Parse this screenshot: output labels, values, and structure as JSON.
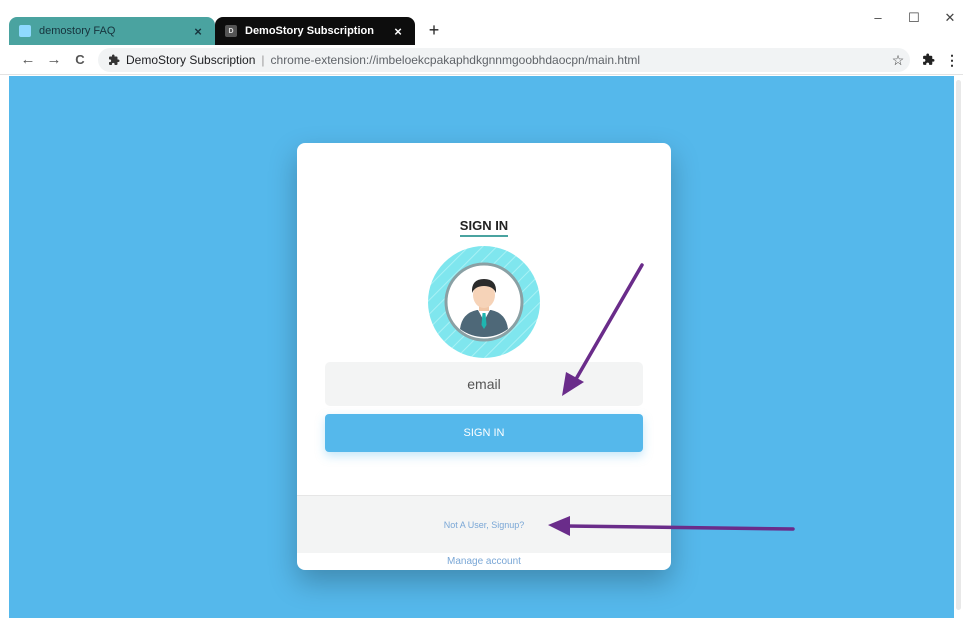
{
  "browser": {
    "tabs": [
      {
        "title": "demostory FAQ",
        "close": "×"
      },
      {
        "title": "DemoStory Subscription",
        "favicon_letter": "D",
        "close": "×"
      }
    ],
    "new_tab": "+",
    "window_controls": {
      "minimize": "–",
      "maximize": "☐",
      "close": "✕"
    },
    "nav": {
      "back": "←",
      "forward": "→",
      "reload": "C"
    },
    "omnibox": {
      "site_name": "DemoStory Subscription",
      "separator": "|",
      "url": "chrome-extension://imbeloekcpakaphdkgnnmgoobhdaocpn/main.html"
    },
    "toolbar_icons": {
      "bookmark": "☆",
      "extensions": "puzzle-icon",
      "menu": "⋮"
    }
  },
  "page": {
    "heading": "SIGN IN",
    "email_placeholder": "email",
    "signin_button": "SIGN IN",
    "signup_link": "Not A User, Signup?",
    "manage_link": "Manage account"
  },
  "colors": {
    "background": "#55b8eb",
    "annotation_arrow": "#6a2c8a",
    "avatar_ring": "#7fe6ee",
    "tab_1": "#4aa3a0",
    "tab_2": "#0d0d0d"
  }
}
